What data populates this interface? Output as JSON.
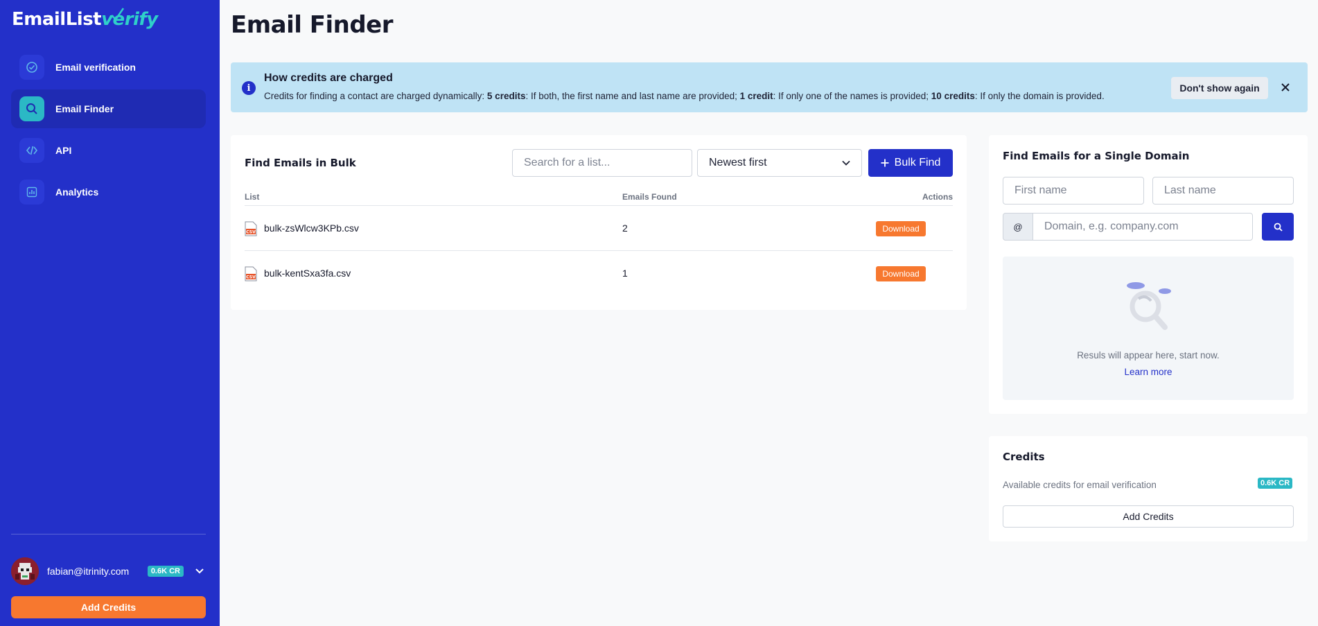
{
  "brand": {
    "part1": "EmailList",
    "part2": "verify"
  },
  "sidebar": {
    "items": [
      {
        "label": "Email verification",
        "icon": "check-circle-icon",
        "active": false
      },
      {
        "label": "Email Finder",
        "icon": "search-icon",
        "active": true
      },
      {
        "label": "API",
        "icon": "code-icon",
        "active": false
      },
      {
        "label": "Analytics",
        "icon": "chart-icon",
        "active": false
      }
    ],
    "user_email": "fabian@itrinity.com",
    "credits_badge": "0.6K CR",
    "add_credits": "Add Credits"
  },
  "page": {
    "title": "Email Finder"
  },
  "banner": {
    "title": "How credits are charged",
    "text_parts": [
      "Credits for finding a contact are charged dynamically: ",
      "5 credits",
      ": If both, the first name and last name are provided; ",
      "1 credit",
      ": If only one of the names is provided; ",
      "10 credits",
      ": If only the domain is provided."
    ],
    "dont_show": "Don't show again"
  },
  "bulk": {
    "title": "Find Emails in Bulk",
    "search_placeholder": "Search for a list...",
    "sort_value": "Newest first",
    "bulk_button": "Bulk Find",
    "columns": [
      "List",
      "Emails Found",
      "Actions"
    ],
    "rows": [
      {
        "name": "bulk-zsWlcw3KPb.csv",
        "found": "2",
        "action": "Download"
      },
      {
        "name": "bulk-kentSxa3fa.csv",
        "found": "1",
        "action": "Download"
      }
    ]
  },
  "single": {
    "title": "Find Emails for a Single Domain",
    "first_placeholder": "First name",
    "last_placeholder": "Last name",
    "at_symbol": "@",
    "domain_placeholder": "Domain, e.g. company.com",
    "results_text": "Resuls will appear here, start now.",
    "learn_more": "Learn more"
  },
  "credits": {
    "title": "Credits",
    "description": "Available credits for email verification",
    "badge": "0.6K CR",
    "add_button": "Add Credits"
  },
  "colors": {
    "sidebar": "#2330c9",
    "accent_teal": "#2bb8c5",
    "orange": "#f7782f",
    "banner": "#bfe3f5"
  }
}
